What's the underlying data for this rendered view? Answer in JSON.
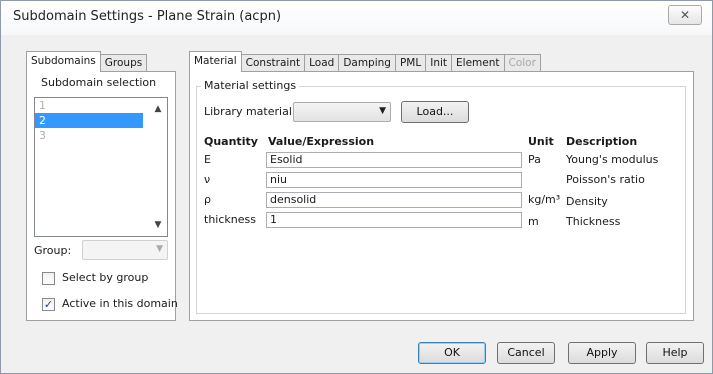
{
  "window": {
    "title": "Subdomain Settings - Plane Strain (acpn)",
    "close_glyph": "✕"
  },
  "left_tabs": [
    {
      "label": "Subdomains",
      "active": true
    },
    {
      "label": "Groups",
      "active": false
    }
  ],
  "subdomain_selection": {
    "legend": "Subdomain selection",
    "items": [
      "1",
      "2",
      "3"
    ],
    "selected_index": 1,
    "scroll_up_glyph": "▲",
    "scroll_down_glyph": "▼"
  },
  "group": {
    "label": "Group:",
    "value": "",
    "arrow_glyph": "▼"
  },
  "checkboxes": {
    "select_by_group": {
      "label": "Select by group",
      "checked": false
    },
    "active_in_domain": {
      "label": "Active in this domain",
      "checked": true,
      "glyph": "✓"
    }
  },
  "right_tabs": [
    {
      "label": "Material",
      "active": true
    },
    {
      "label": "Constraint"
    },
    {
      "label": "Load"
    },
    {
      "label": "Damping"
    },
    {
      "label": "PML"
    },
    {
      "label": "Init"
    },
    {
      "label": "Element"
    },
    {
      "label": "Color",
      "disabled": true
    }
  ],
  "material": {
    "legend": "Material settings",
    "library_label": "Library material:",
    "library_value": "",
    "arrow_glyph": "▼",
    "load_button": "Load..."
  },
  "table": {
    "headers": {
      "quantity": "Quantity",
      "value": "Value/Expression",
      "unit": "Unit",
      "description": "Description"
    },
    "rows": [
      {
        "quantity": "E",
        "value": "Esolid",
        "unit": "Pa",
        "description": "Young's modulus"
      },
      {
        "quantity": "ν",
        "value": "niu",
        "unit": "",
        "description": "Poisson's ratio"
      },
      {
        "quantity": "ρ",
        "value": "densolid",
        "unit": "kg/m³",
        "description": "Density"
      },
      {
        "quantity": "thickness",
        "value": "1",
        "unit": "m",
        "description": "Thickness"
      }
    ]
  },
  "buttons": {
    "ok": "OK",
    "cancel": "Cancel",
    "apply": "Apply",
    "help": "Help"
  }
}
